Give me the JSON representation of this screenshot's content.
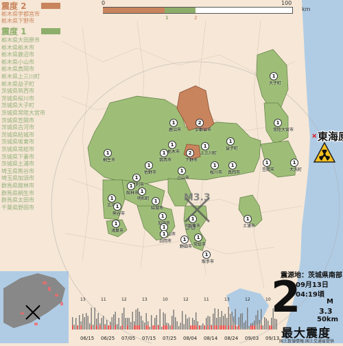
{
  "map": {
    "title_epicenter_label": "震源地：茨城県南部",
    "date": "09月13日",
    "time": "04:19頃",
    "max_intensity": "2",
    "max_intensity_label": "最大震度",
    "magnitude_label": "M",
    "magnitude": "3.3",
    "depth": "50km",
    "credit": "国土数値情報:国土交通省提供",
    "epicenter_marker_top": "M3.3",
    "epicenter_marker_bottom": "50",
    "nuclear_label": "東海原",
    "colors": {
      "intensity2": "#c8845d",
      "intensity1": "#8cae6a",
      "land": "#f6e7d6",
      "sea": "#b0cce5"
    }
  },
  "scale": {
    "ticks": [
      "0",
      "100"
    ],
    "unit": "km",
    "legend": [
      "1",
      "2"
    ]
  },
  "region_list": {
    "level2": {
      "title": "震度 2",
      "items": [
        "栃木県宇都宮市",
        "栃木県下野市"
      ]
    },
    "level1": {
      "title": "震度 1",
      "items": [
        "栃木県大田原市",
        "栃木県栃木市",
        "栃木県鹿沼市",
        "栃木県小山市",
        "栃木県真岡市",
        "栃木県上三川町",
        "栃木県益子町",
        "茨城県筑西市",
        "茨城県桜川市",
        "茨城県大子町",
        "茨城県常陸大宮市",
        "茨城県笠間市",
        "茨城県古河市",
        "茨城県結城市",
        "茨城県坂東市",
        "茨城県常総市",
        "茨城県下妻市",
        "茨城県土浦市",
        "埼玉県熊谷市",
        "埼玉県加須市",
        "群馬県館林市",
        "群馬県桐生市",
        "群馬県太田市",
        "千葉県野田市"
      ]
    }
  },
  "place_labels": [
    {
      "name": "大子町",
      "intensity": "1"
    },
    {
      "name": "常陸大宮市",
      "intensity": "1"
    },
    {
      "name": "鹿沼市",
      "intensity": "1"
    },
    {
      "name": "宇都宮市",
      "intensity": "2"
    },
    {
      "name": "益子町",
      "intensity": "1"
    },
    {
      "name": "上三川町",
      "intensity": "1"
    },
    {
      "name": "下野市",
      "intensity": "2"
    },
    {
      "name": "栃木市",
      "intensity": "1"
    },
    {
      "name": "真岡市",
      "intensity": "1"
    },
    {
      "name": "桐生市",
      "intensity": "1"
    },
    {
      "name": "佐野市",
      "intensity": "1"
    },
    {
      "name": "足利市",
      "intensity": "1"
    },
    {
      "name": "小山市",
      "intensity": "1"
    },
    {
      "name": "筑西市",
      "intensity": "1"
    },
    {
      "name": "桜川市",
      "intensity": "1"
    },
    {
      "name": "笠間市",
      "intensity": "1"
    },
    {
      "name": "大洗町",
      "intensity": "1"
    },
    {
      "name": "館林市",
      "intensity": "1"
    },
    {
      "name": "明和町",
      "intensity": "1"
    },
    {
      "name": "古河市",
      "intensity": "1"
    },
    {
      "name": "結城市",
      "intensity": "1"
    },
    {
      "name": "熊谷市",
      "intensity": "1"
    },
    {
      "name": "加須市",
      "intensity": "1"
    },
    {
      "name": "坂東市",
      "intensity": "1"
    },
    {
      "name": "常総市",
      "intensity": "1"
    },
    {
      "name": "土浦市",
      "intensity": "1"
    },
    {
      "name": "鴻巣市",
      "intensity": "1"
    },
    {
      "name": "東松山市",
      "intensity": "1"
    },
    {
      "name": "野田市",
      "intensity": "1"
    },
    {
      "name": "白岡市",
      "intensity": "1"
    },
    {
      "name": "取手市",
      "intensity": "1"
    }
  ],
  "history": {
    "dates": [
      "06/15",
      "06/25",
      "07/05",
      "07/15",
      "07/25",
      "08/04",
      "08/14",
      "08/24",
      "09/03",
      "09/13"
    ],
    "peak_counts": [
      "13",
      "11",
      "12",
      "13",
      "10",
      "12",
      "11",
      "13",
      "12",
      "10"
    ]
  }
}
